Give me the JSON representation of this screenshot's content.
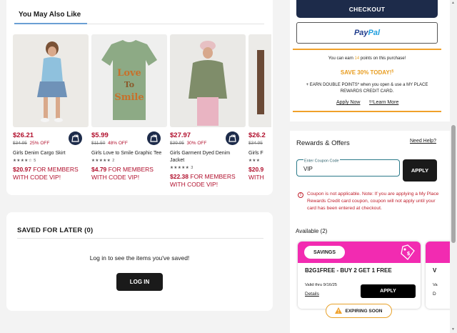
{
  "recommendations": {
    "title": "You May Also Like",
    "products": [
      {
        "price": "$26.21",
        "was": "$34.95",
        "off": "25% OFF",
        "name": "Girls Denim Cargo Skirt",
        "stars": "★★★★☆",
        "reviews": "5",
        "member_price": "$20.97",
        "member_text": "FOR MEMBERS WITH CODE VIP!"
      },
      {
        "price": "$5.99",
        "was": "$11.50",
        "off": "48% OFF",
        "name": "Girls Love to Smile Graphic Tee",
        "stars": "★★★★★",
        "reviews": "2",
        "member_price": "$4.79",
        "member_text": "FOR MEMBERS WITH CODE VIP!"
      },
      {
        "price": "$27.97",
        "was": "$39.95",
        "off": "30% OFF",
        "name": "Girls Garment Dyed Denim Jacket",
        "stars": "★★★★★",
        "reviews": "3",
        "member_price": "$22.38",
        "member_text": "FOR MEMBERS WITH CODE VIP!"
      },
      {
        "price": "$26.2",
        "was": "$34.95",
        "off": "",
        "name": "Girls F",
        "stars": "★★★",
        "reviews": "",
        "member_price": "$20.9",
        "member_text": "WITH"
      }
    ]
  },
  "saved_for_later": {
    "title": "SAVED FOR LATER (0)",
    "message": "Log in to see the items you've saved!",
    "login_label": "LOG IN"
  },
  "checkout": {
    "checkout_label": "CHECKOUT",
    "paypal_a": "Pay",
    "paypal_b": "Pal",
    "earn_prefix": "You can earn",
    "earn_points": "14",
    "earn_suffix": "points on this purchase!",
    "save_offer": "SAVE 30% TODAY!",
    "save_sup": "§",
    "double_points": "+ EARN DOUBLE POINTS* when you open & use a MY PLACE REWARDS CREDIT CARD.",
    "apply_now": "Apply Now",
    "learn_more_sup": "§†",
    "learn_more": "Learn More"
  },
  "rewards": {
    "title": "Rewards & Offers",
    "need_help": "Need Help?",
    "coupon_label": "Enter Coupon Code",
    "coupon_value": "VIP",
    "apply_label": "APPLY",
    "error_icon": "!",
    "error": "Coupon is not applicable. Note: If you are applying a My Place Rewards Credit card coupon, coupon will not apply until your card has been entered at checkout.",
    "available": "Available (2)",
    "coupons": [
      {
        "tag": "SAVINGS",
        "title": "B2G1FREE - BUY 2 GET 1 FREE",
        "valid": "Valid thru 9/16/25",
        "details": "Details",
        "apply": "APPLY"
      },
      {
        "title": "V",
        "valid": "Va",
        "details": "D"
      }
    ],
    "expiring": "EXPIRING SOON"
  },
  "colors": {
    "brand_navy": "#1d2b4a",
    "sale_red": "#b1102d",
    "coupon_pink": "#f22bb1",
    "reward_orange": "#f0a12a"
  }
}
